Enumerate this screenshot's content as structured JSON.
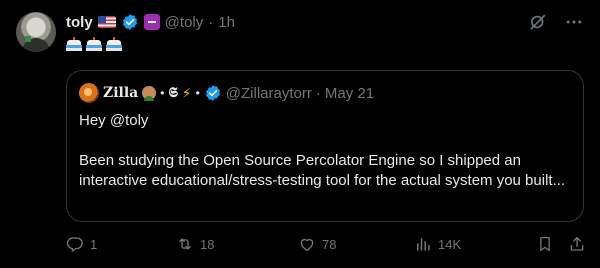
{
  "author": {
    "name": "toly",
    "handle": "@toly",
    "separator": "·",
    "time": "1h"
  },
  "quote": {
    "name": "Zilla",
    "separator": "•",
    "fraktur_mark": "𝕾",
    "handle": "@Zillaraytorr",
    "date_separator": "·",
    "date": "May 21",
    "greeting": "Hey @toly",
    "body": "Been studying the Open Source Percolator Engine so I shipped an interactive educational/stress-testing tool for the actual system you built..."
  },
  "actions": {
    "replies": "1",
    "reposts": "18",
    "likes": "78",
    "views": "14K"
  },
  "colors": {
    "background": "#000000",
    "text": "#e7e9ea",
    "muted": "#71767b",
    "border": "#2f3336",
    "verified": "#1d9bf0"
  },
  "icons": [
    "grok-icon",
    "more-icon",
    "reply-icon",
    "retweet-icon",
    "like-icon",
    "views-icon",
    "bookmark-icon",
    "share-icon"
  ]
}
